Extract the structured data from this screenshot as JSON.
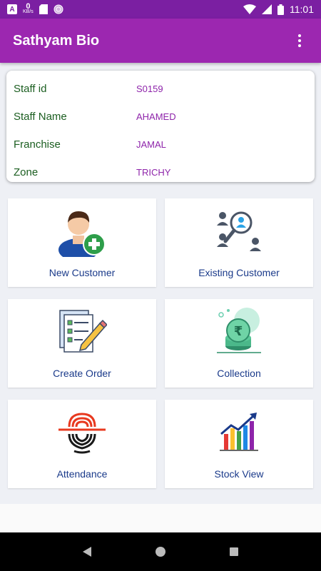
{
  "status_bar": {
    "speed_value": "0",
    "speed_unit": "KB/s",
    "time": "11:01"
  },
  "app_bar": {
    "title": "Sathyam Bio"
  },
  "staff_info": {
    "rows": [
      {
        "label": "Staff id",
        "value": "S0159"
      },
      {
        "label": "Staff Name",
        "value": "AHAMED"
      },
      {
        "label": "Franchise",
        "value": "JAMAL"
      },
      {
        "label": "Zone",
        "value": "TRICHY"
      }
    ]
  },
  "menu": {
    "tiles": [
      {
        "label": "New Customer",
        "icon": "add-user-icon"
      },
      {
        "label": "Existing Customer",
        "icon": "search-customer-icon"
      },
      {
        "label": "Create Order",
        "icon": "checklist-pencil-icon"
      },
      {
        "label": "Collection",
        "icon": "rupee-coins-icon"
      },
      {
        "label": "Attendance",
        "icon": "fingerprint-icon"
      },
      {
        "label": "Stock View",
        "icon": "growth-chart-icon"
      }
    ]
  },
  "colors": {
    "status_bar": "#7b1fa2",
    "app_bar": "#9c27b0",
    "label_green": "#1b5e20",
    "value_purple": "#8e24aa",
    "tile_label_blue": "#1a3a8a"
  }
}
